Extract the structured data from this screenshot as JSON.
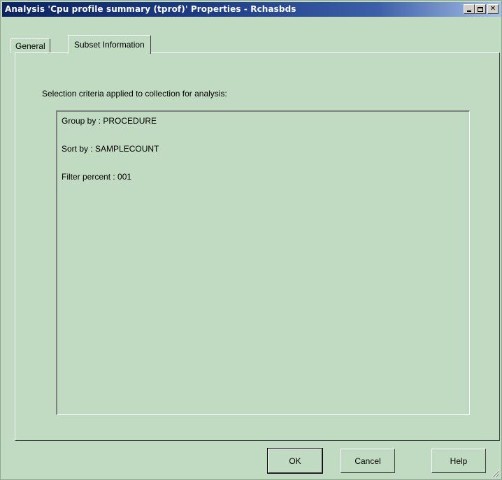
{
  "window": {
    "title": "Analysis 'Cpu profile summary (tprof)' Properties - Rchasbds"
  },
  "tabs": [
    {
      "label": "General",
      "selected": false
    },
    {
      "label": "Subset Information",
      "selected": true
    }
  ],
  "subset": {
    "heading": "Selection criteria applied to collection for analysis:",
    "criteria": [
      "Group by :  PROCEDURE",
      "Sort by : SAMPLECOUNT",
      "Filter percent : 001"
    ]
  },
  "buttons": {
    "ok": "OK",
    "cancel": "Cancel",
    "help": "Help"
  },
  "icons": {
    "minimize": "minimize-icon",
    "maximize": "maximize-icon",
    "close": "close-icon",
    "resize": "resize-grip-icon"
  },
  "colors": {
    "background": "#c1dbc2",
    "titlebar_start": "#0c2462",
    "titlebar_end": "#a6c1e6"
  }
}
